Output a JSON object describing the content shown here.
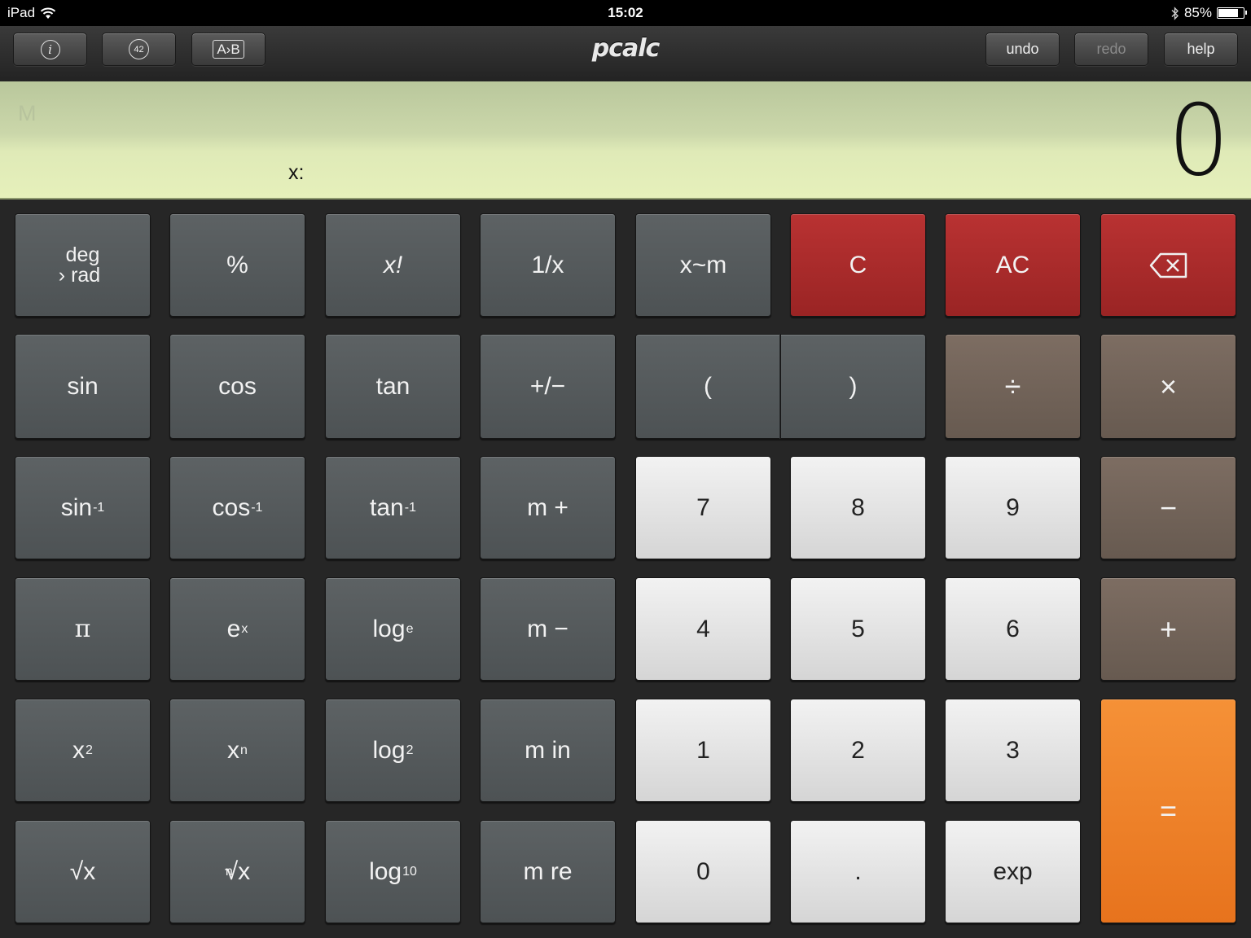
{
  "status": {
    "device": "iPad",
    "time": "15:02",
    "battery_pct": "85%",
    "battery_level": 0.85
  },
  "toolbar": {
    "info_label": "i",
    "badge_label": "42",
    "ab_label": "A›B",
    "logo": "pcalc",
    "undo": "undo",
    "redo": "redo",
    "help": "help"
  },
  "display": {
    "memory_indicator": "M",
    "x_label": "x:",
    "value": "0"
  },
  "keys": {
    "deg_top": "deg",
    "deg_bottom": "› rad",
    "percent": "%",
    "factorial": "x!",
    "reciprocal": "1/x",
    "swap_mem": "x~m",
    "clear": "C",
    "all_clear": "AC",
    "sin": "sin",
    "cos": "cos",
    "tan": "tan",
    "plus_minus": "+/−",
    "open_paren": "(",
    "close_paren": ")",
    "divide": "÷",
    "multiply": "×",
    "asin_base": "sin",
    "acos_base": "cos",
    "atan_base": "tan",
    "inv_exp": "-1",
    "m_plus": "m +",
    "seven": "7",
    "eight": "8",
    "nine": "9",
    "minus": "−",
    "pi": "π",
    "ex_base": "e",
    "ex_exp": "x",
    "loge_base": "log",
    "loge_sub": "e",
    "m_minus": "m −",
    "four": "4",
    "five": "5",
    "six": "6",
    "plus": "+",
    "x2_base": "x",
    "x2_exp": "2",
    "xn_base": "x",
    "xn_exp": "n",
    "log2_base": "log",
    "log2_sub": "2",
    "m_in": "m in",
    "one": "1",
    "two": "2",
    "three": "3",
    "equals": "=",
    "sqrt": "√x",
    "nroot_idx": "n",
    "nroot": "√x",
    "log10_base": "log",
    "log10_sub": "10",
    "m_re": "m re",
    "zero": "0",
    "dot": ".",
    "exp": "exp"
  }
}
